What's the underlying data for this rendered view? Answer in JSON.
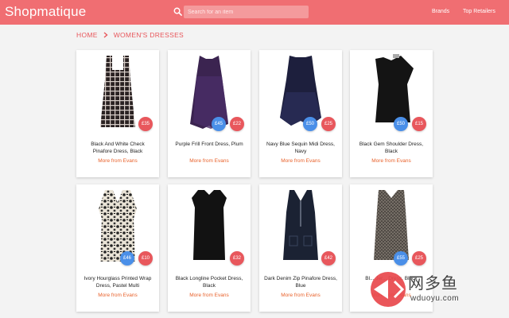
{
  "header": {
    "brand": "Shopmatique",
    "search_placeholder": "Search for an item",
    "links": [
      "Brands",
      "Top Retailers"
    ]
  },
  "breadcrumb": {
    "home": "HOME",
    "current": "WOMEN'S DRESSES"
  },
  "colors": {
    "header": "#f06e72",
    "accent": "#e8575c",
    "sale_badge": "#4a8fe8",
    "link": "#e8612a"
  },
  "products": [
    {
      "name": "Black And White Check Pinafore Dress, Black",
      "price": "£35",
      "old_price": "",
      "more": "More from Evans"
    },
    {
      "name": "Purple Frill Front Dress, Plum",
      "price": "£22",
      "old_price": "£45",
      "more": "More from Evans"
    },
    {
      "name": "Navy Blue Sequin Midi Dress, Navy",
      "price": "£25",
      "old_price": "£50",
      "more": "More from Evans"
    },
    {
      "name": "Black Gem Shoulder Dress, Black",
      "price": "£15",
      "old_price": "£50",
      "more": "More from Evans"
    },
    {
      "name": "Ivory Hourglass Printed Wrap Dress, Pastel Multi",
      "price": "£10",
      "old_price": "£46",
      "more": "More from Evans"
    },
    {
      "name": "Black Longline Pocket Dress, Black",
      "price": "£32",
      "old_price": "",
      "more": "More from Evans"
    },
    {
      "name": "Dark Denim Zip Pinafore Dress, Blue",
      "price": "£42",
      "old_price": "",
      "more": "More from Evans"
    },
    {
      "name": "Bl... Jer... Dress, Black",
      "price": "£25",
      "old_price": "£55",
      "more": "More from Evans"
    }
  ],
  "watermark": {
    "main": "网多鱼",
    "sub": "wduoyu.com"
  }
}
